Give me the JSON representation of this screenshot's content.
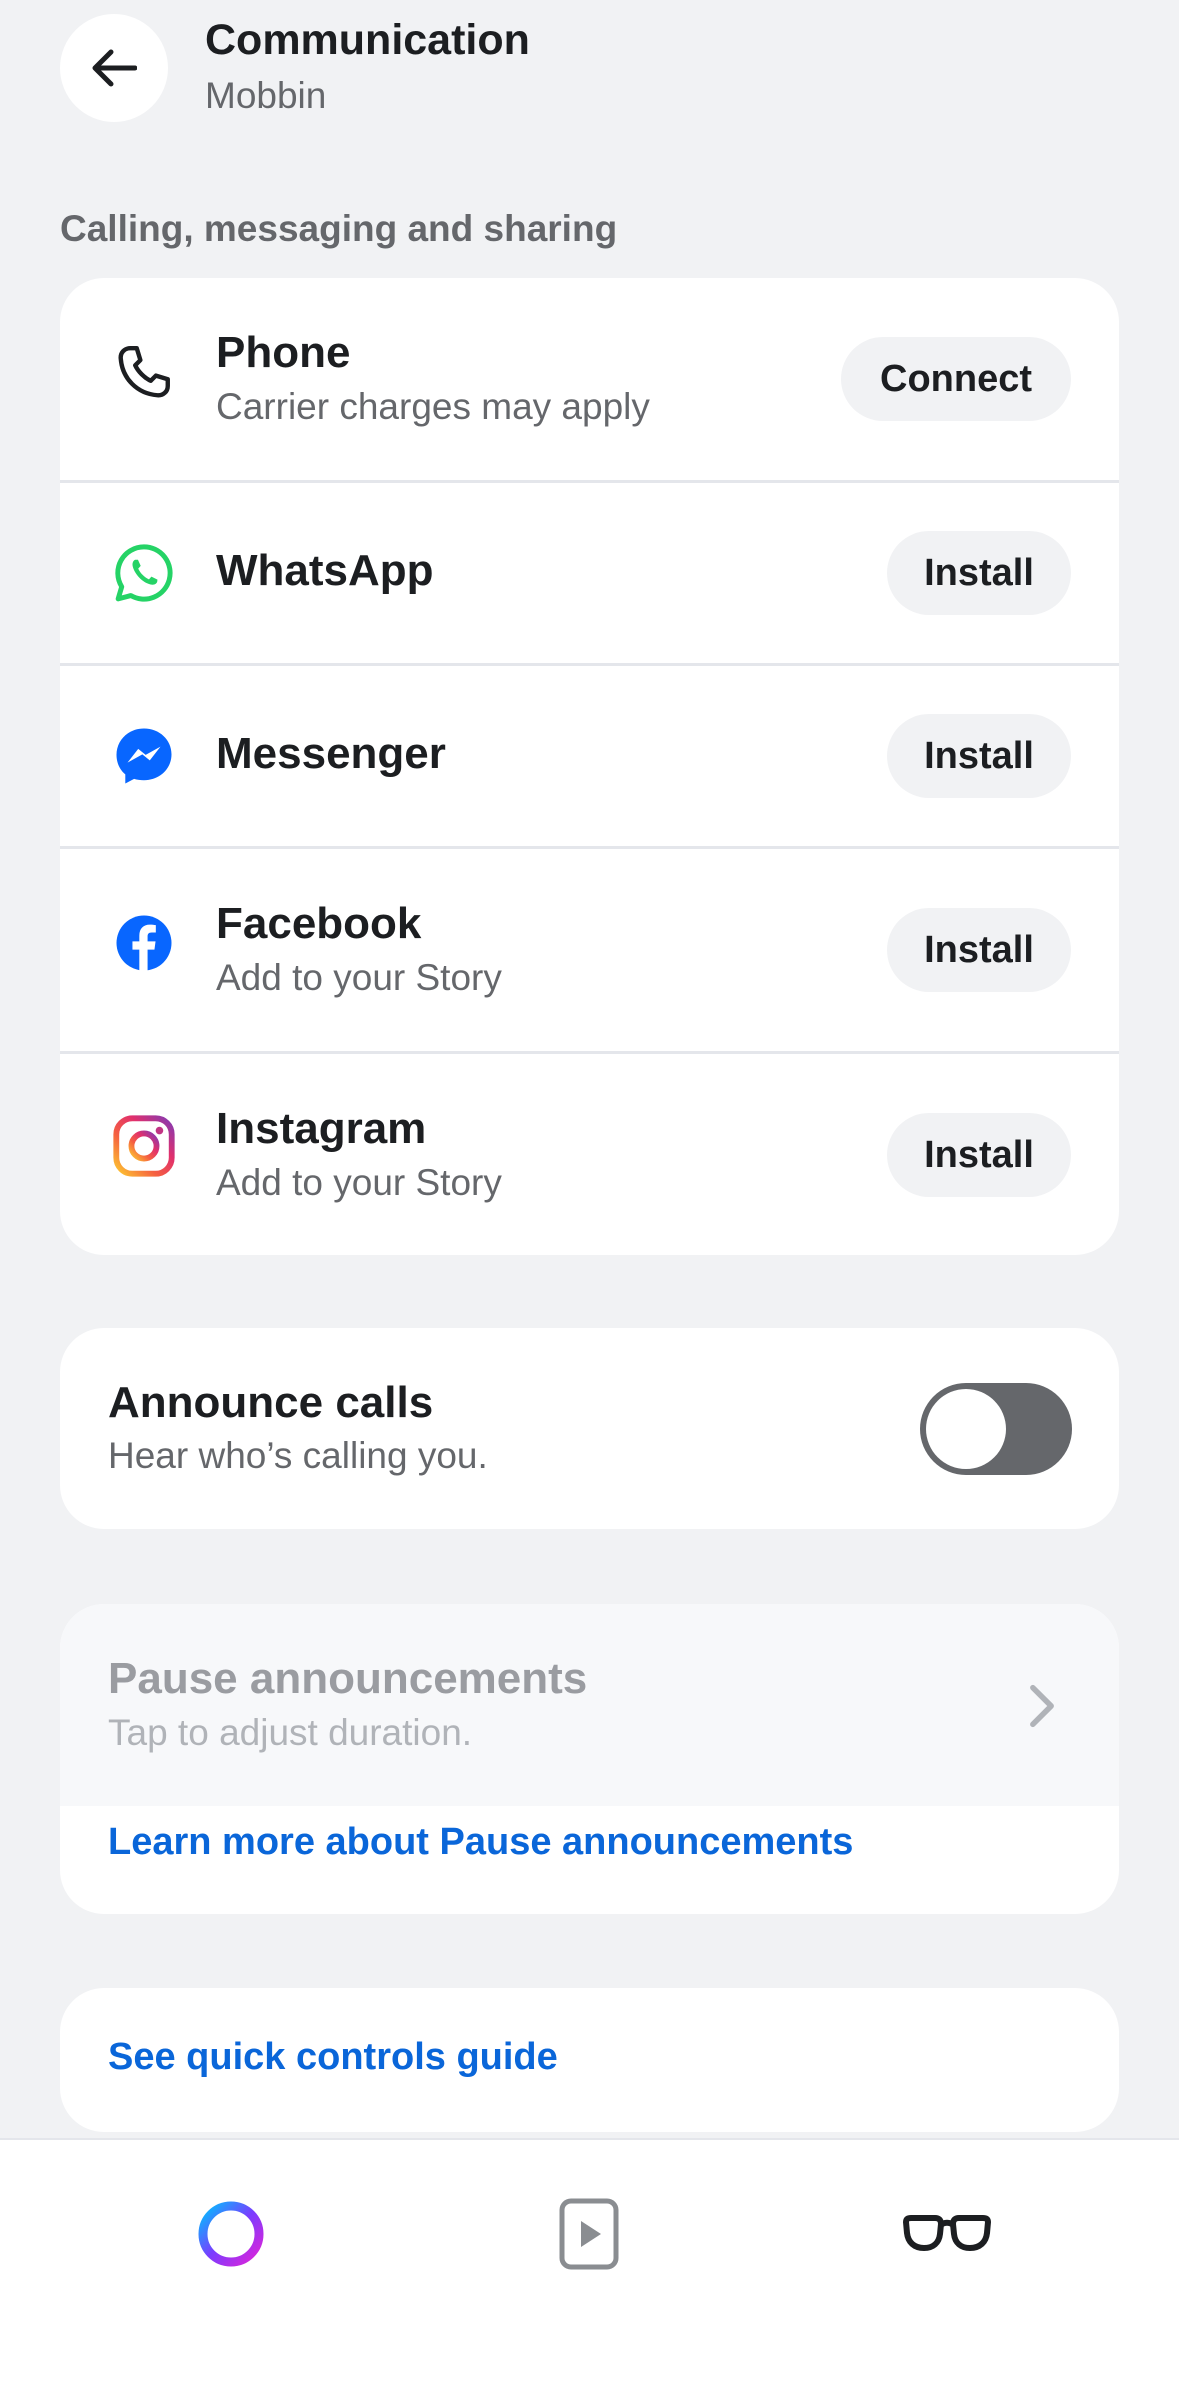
{
  "header": {
    "title": "Communication",
    "subtitle": "Mobbin",
    "back_icon": "arrow-left-icon"
  },
  "section": {
    "label": "Calling, messaging and sharing"
  },
  "apps": [
    {
      "name": "Phone",
      "subtitle": "Carrier charges may apply",
      "action": "Connect",
      "icon": "phone-icon"
    },
    {
      "name": "WhatsApp",
      "subtitle": "",
      "action": "Install",
      "icon": "whatsapp-icon",
      "color": "#25d366"
    },
    {
      "name": "Messenger",
      "subtitle": "",
      "action": "Install",
      "icon": "messenger-icon",
      "color": "#0866ff"
    },
    {
      "name": "Facebook",
      "subtitle": "Add to your Story",
      "action": "Install",
      "icon": "facebook-icon",
      "color": "#0866ff"
    },
    {
      "name": "Instagram",
      "subtitle": "Add to your Story",
      "action": "Install",
      "icon": "instagram-icon"
    }
  ],
  "announce": {
    "title": "Announce calls",
    "subtitle": "Hear who’s calling you.",
    "toggle_on": false
  },
  "pause": {
    "title": "Pause announcements",
    "subtitle": "Tap to adjust duration.",
    "link": "Learn more about Pause announcements"
  },
  "guide": {
    "link": "See quick controls guide"
  },
  "tabbar": {
    "tabs": [
      {
        "icon": "meta-ai-ring-icon"
      },
      {
        "icon": "play-media-icon"
      },
      {
        "icon": "glasses-icon"
      }
    ]
  },
  "colors": {
    "link": "#0a66d9",
    "background": "#f1f2f4",
    "toggle_off": "#65676b"
  }
}
